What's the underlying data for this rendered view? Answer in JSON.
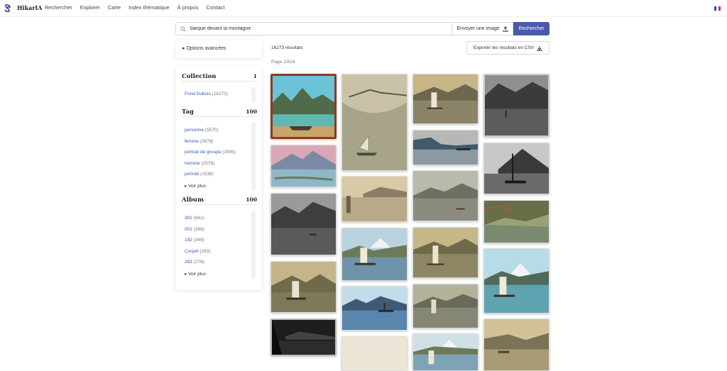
{
  "nav": {
    "brand": "HikarIA",
    "links": [
      "Rechercher",
      "Explorer",
      "Carte",
      "Index thématique",
      "À propos",
      "Contact"
    ]
  },
  "search": {
    "value": "barque devant la montagne",
    "upload_label": "Envoyer une image",
    "button_label": "Rechercher"
  },
  "advanced_options": "▸ Options avancées",
  "facets": {
    "collection": {
      "title": "Collection",
      "count": "1",
      "items": [
        {
          "label": "Fond Dubois",
          "count": "(16273)"
        }
      ]
    },
    "tag": {
      "title": "Tag",
      "count": "100",
      "items": [
        {
          "label": "personne",
          "count": "(5570)"
        },
        {
          "label": "femme",
          "count": "(3678)"
        },
        {
          "label": "portrait de groupe",
          "count": "(2995)"
        },
        {
          "label": "homme",
          "count": "(2576)"
        },
        {
          "label": "portrait",
          "count": "(1538)"
        }
      ],
      "more": "▸ Voir plus"
    },
    "album": {
      "title": "Album",
      "count": "100",
      "items": [
        {
          "label": "302",
          "count": "(661)"
        },
        {
          "label": "001",
          "count": "(399)"
        },
        {
          "label": "192",
          "count": "(349)"
        },
        {
          "label": "Corpet",
          "count": "(283)"
        },
        {
          "label": "283",
          "count": "(278)"
        }
      ],
      "more": "▸ Voir plus"
    }
  },
  "results": {
    "count_text": "16273 résultats",
    "csv_label": "Exporter les résultats en CSV",
    "page_text": "Page 1/814"
  },
  "colors": {
    "accent": "#4a5aa8",
    "link": "#3b55b5"
  }
}
